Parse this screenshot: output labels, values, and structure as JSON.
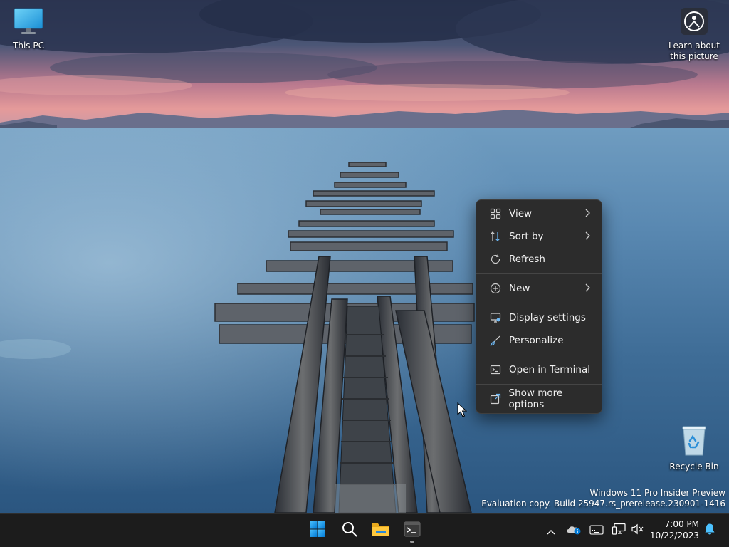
{
  "desktop": {
    "icons": [
      {
        "label": "This PC"
      },
      {
        "label": "Recycle Bin"
      }
    ],
    "spotlight": {
      "label_line1": "Learn about",
      "label_line2": "this picture"
    }
  },
  "watermark": {
    "line1": "Windows 11 Pro Insider Preview",
    "line2": "Evaluation copy. Build 25947.rs_prerelease.230901-1416"
  },
  "context_menu": {
    "items": [
      {
        "label": "View",
        "icon": "grid-icon",
        "submenu": true
      },
      {
        "label": "Sort by",
        "icon": "sort-icon",
        "submenu": true
      },
      {
        "label": "Refresh",
        "icon": "refresh-icon",
        "submenu": false
      },
      {
        "label": "New",
        "icon": "plus-circle-icon",
        "submenu": true
      },
      {
        "label": "Display settings",
        "icon": "display-icon",
        "submenu": false
      },
      {
        "label": "Personalize",
        "icon": "brush-icon",
        "submenu": false
      },
      {
        "label": "Open in Terminal",
        "icon": "terminal-icon",
        "submenu": false
      },
      {
        "label": "Show more options",
        "icon": "share-icon",
        "submenu": false
      }
    ]
  },
  "taskbar": {
    "apps": [
      {
        "name": "Start",
        "icon": "windows-logo-icon"
      },
      {
        "name": "Search",
        "icon": "search-icon"
      },
      {
        "name": "File Explorer",
        "icon": "folder-icon"
      },
      {
        "name": "Terminal",
        "icon": "terminal-icon",
        "running": true
      }
    ],
    "tray": {
      "time": "7:00 PM",
      "date": "10/22/2023"
    }
  },
  "colors": {
    "accent": "#0078d4",
    "menu_bg": "#2c2c2c",
    "taskbar_bg": "#1c1c1c"
  }
}
